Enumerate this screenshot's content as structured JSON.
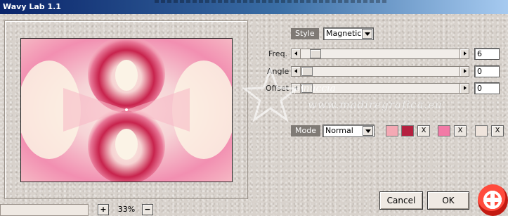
{
  "window": {
    "title": "Wavy Lab 1.1"
  },
  "style": {
    "label": "Style",
    "value": "Magnetic"
  },
  "params": [
    {
      "key": "freq",
      "label": "Freq.",
      "value": "6",
      "level": 0.06
    },
    {
      "key": "angle",
      "label": "Angle",
      "value": "0",
      "level": 0.0
    },
    {
      "key": "offset",
      "label": "Offset",
      "value": "0",
      "level": 0.0
    }
  ],
  "mode": {
    "label": "Mode",
    "value": "Normal"
  },
  "colors": {
    "swatch_1": "#f4a9b4",
    "swatch_2": "#b5203f",
    "swatch_3": "#f27aa6",
    "swatch_4": "#efe4dc",
    "remove_symbol": "X"
  },
  "zoom": {
    "plus": "+",
    "minus": "−",
    "value": "33%"
  },
  "watermark": {
    "name": "pinuccia",
    "url": "www.madiregrafica.eu"
  },
  "buttons": {
    "cancel": "Cancel",
    "ok": "OK"
  }
}
